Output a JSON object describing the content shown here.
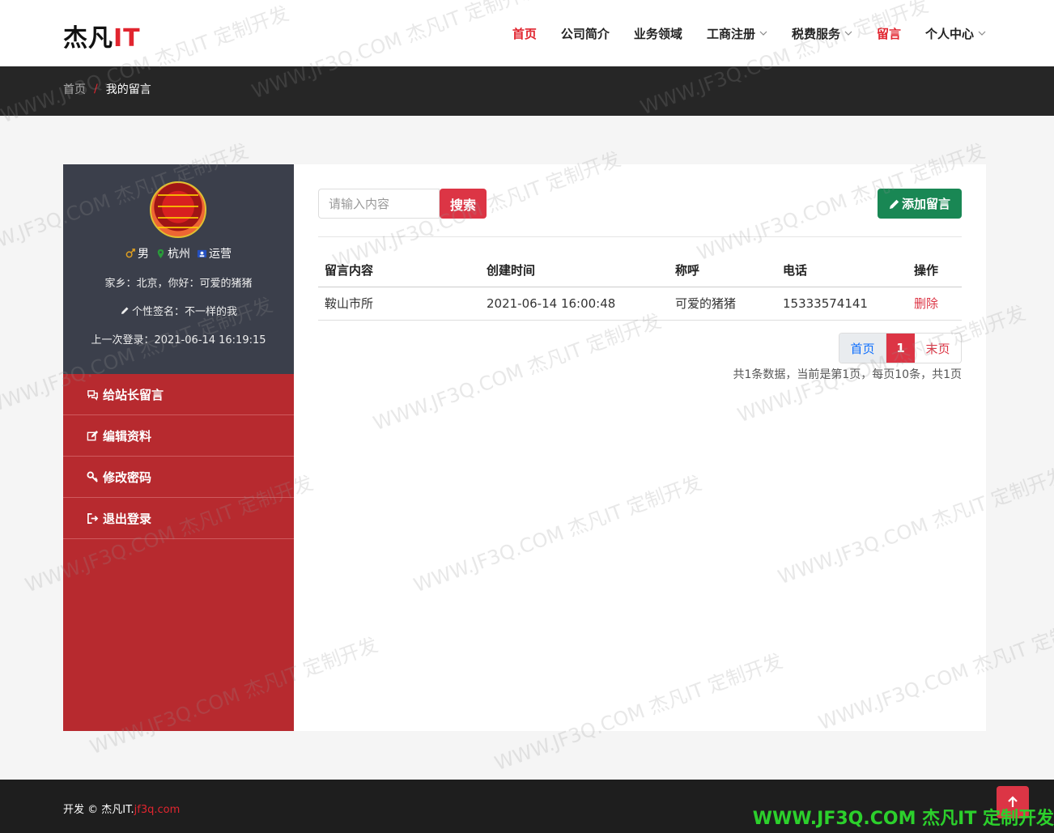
{
  "header": {
    "logo_main": "杰凡",
    "logo_accent": "IT",
    "nav": [
      {
        "label": "首页",
        "active": true,
        "dropdown": false
      },
      {
        "label": "公司简介",
        "active": false,
        "dropdown": false
      },
      {
        "label": "业务领域",
        "active": false,
        "dropdown": false
      },
      {
        "label": "工商注册",
        "active": false,
        "dropdown": true
      },
      {
        "label": "税费服务",
        "active": false,
        "dropdown": true
      },
      {
        "label": "留言",
        "active": true,
        "dropdown": false
      },
      {
        "label": "个人中心",
        "active": false,
        "dropdown": true
      }
    ]
  },
  "breadcrumb": {
    "home": "首页",
    "separator": "/",
    "current": "我的留言"
  },
  "profile": {
    "gender": "男",
    "city": "杭州",
    "role": "运营",
    "hometown_line": "家乡：北京，你好：可爱的猪猪",
    "signature_line": "个性签名：不一样的我",
    "last_login_line": "上一次登录：2021-06-14 16:19:15"
  },
  "menu": [
    {
      "label": "给站长留言",
      "icon": "comments-icon"
    },
    {
      "label": "编辑资料",
      "icon": "edit-icon"
    },
    {
      "label": "修改密码",
      "icon": "key-icon"
    },
    {
      "label": "退出登录",
      "icon": "sign-out-icon"
    }
  ],
  "search": {
    "placeholder": "请输入内容",
    "value": "",
    "button": "搜索"
  },
  "add_button": "添加留言",
  "table": {
    "headers": [
      "留言内容",
      "创建时间",
      "称呼",
      "电话",
      "操作"
    ],
    "rows": [
      {
        "content": "鞍山市所",
        "created": "2021-06-14 16:00:48",
        "name": "可爱的猪猪",
        "phone": "15333574141",
        "action": "删除"
      }
    ]
  },
  "pagination": {
    "first": "首页",
    "current": "1",
    "last": "末页",
    "info": "共1条数据，当前是第1页，每页10条，共1页"
  },
  "footer": {
    "copyright": "开发 © 杰凡IT.",
    "site": "jf3q.com",
    "watermark_banner": "WWW.JF3Q.COM 杰凡IT  定制开发"
  },
  "watermark": "WWW.JF3Q.COM 杰凡IT  定制开发",
  "colors": {
    "accent": "#e1252f",
    "danger": "#dc3545",
    "success": "#198754",
    "sidebar": "#b72a2f",
    "profile_bg": "#3b3f4b",
    "band": "#262626"
  }
}
